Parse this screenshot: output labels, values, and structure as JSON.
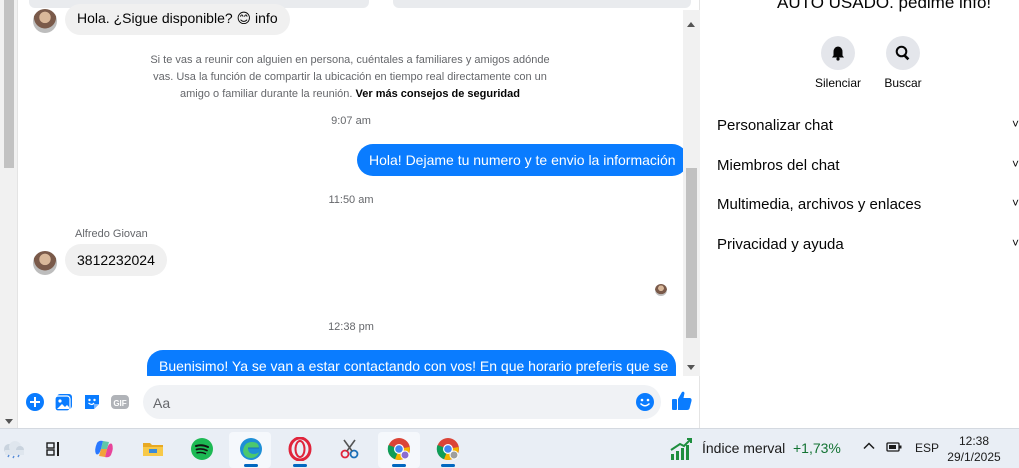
{
  "chat": {
    "first_message": "Hola. ¿Sigue disponible? 😊 info",
    "safety_text": "Si te vas a reunir con alguien en persona, cuéntales a familiares y amigos adónde vas. Usa la función de compartir la ubicación en tiempo real directamente con un amigo o familiar durante la reunión.",
    "safety_link": "Ver más consejos de seguridad",
    "time_1": "9:07 am",
    "out_message_1": "Hola! Dejame tu numero y te envio la información",
    "time_2": "11:50 am",
    "sender_name": "Alfredo Giovan",
    "in_message_2": "3812232024",
    "time_3": "12:38 pm",
    "out_message_2": "Buenisimo! Ya se van a estar contactando con vos! En que horario preferis que se"
  },
  "composer": {
    "placeholder": "Aa"
  },
  "right_panel": {
    "title": "AUTO USADO. pedime info!",
    "actions": [
      {
        "label": "Silenciar",
        "icon": "bell-icon"
      },
      {
        "label": "Buscar",
        "icon": "search-icon"
      }
    ],
    "menu": [
      {
        "label": "Personalizar chat"
      },
      {
        "label": "Miembros del chat"
      },
      {
        "label": "Multimedia, archivos y enlaces"
      },
      {
        "label": "Privacidad y ayuda"
      }
    ]
  },
  "taskbar": {
    "widget_label": "Índice merval",
    "widget_change": "+1,73%",
    "language": "ESP",
    "time": "12:38",
    "date": "29/1/2025"
  },
  "colors": {
    "accent": "#0a7cff",
    "positive": "#137333"
  }
}
